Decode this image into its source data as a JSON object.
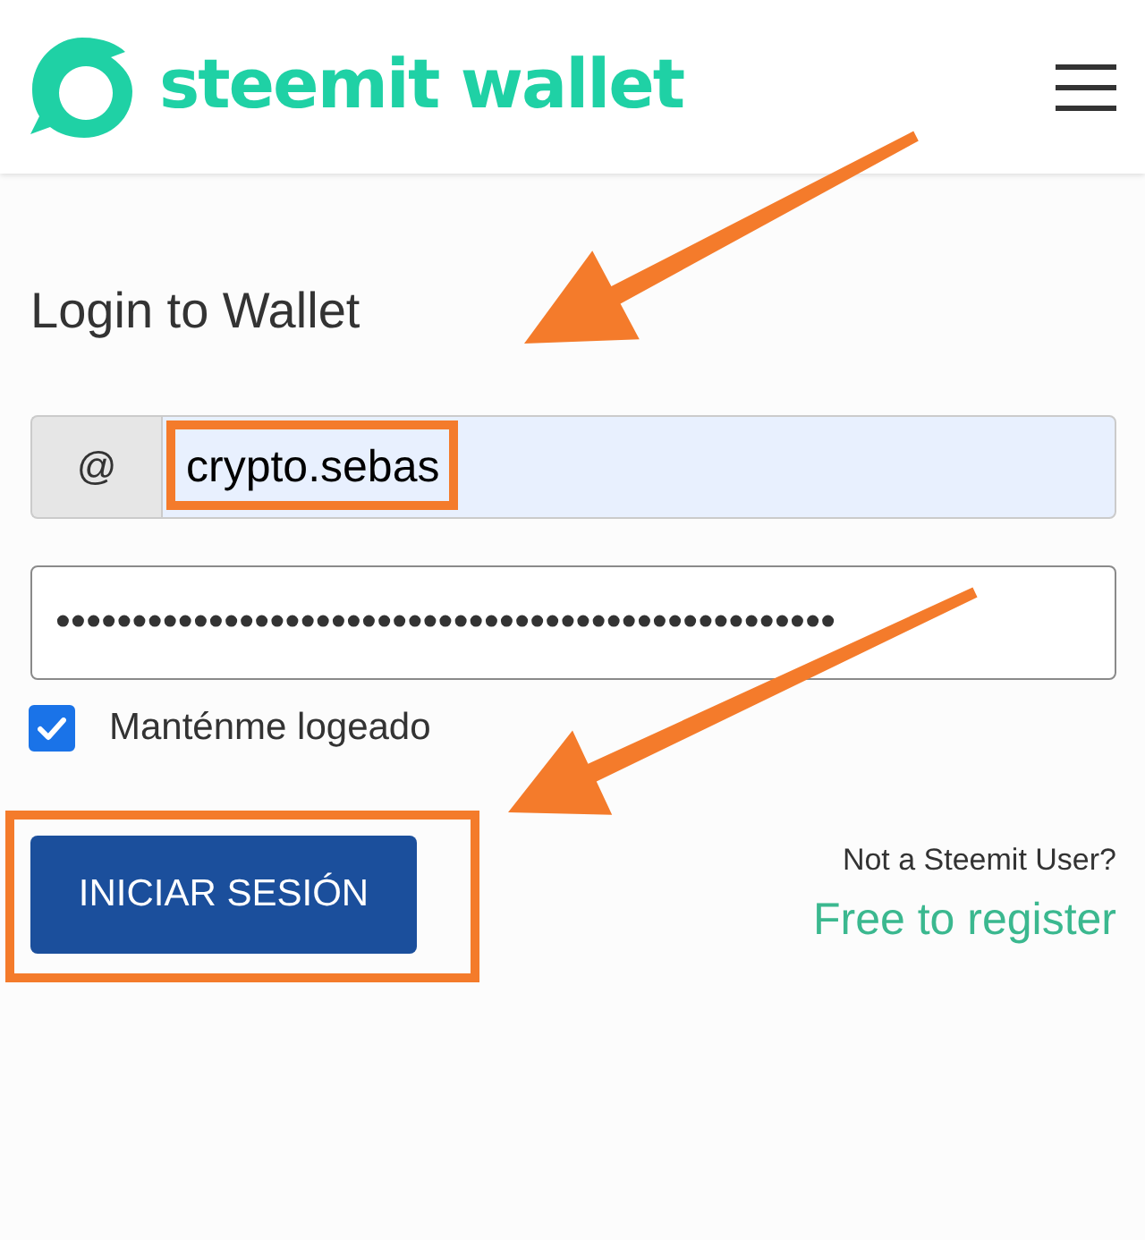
{
  "header": {
    "logo_text": "steemit wallet"
  },
  "login": {
    "title": "Login to Wallet",
    "username": {
      "prefix": "@",
      "value": "crypto.sebas",
      "highlighted": true
    },
    "password": {
      "value": "•••••••••••••••••••••••••••••••••••••••••••••••••••"
    },
    "remember": {
      "label": "Manténme logeado",
      "checked": true
    },
    "submit": {
      "label": "INICIAR SESIÓN",
      "highlighted": true
    },
    "signup": {
      "prompt": "Not a Steemit User?",
      "link": "Free to register"
    }
  }
}
